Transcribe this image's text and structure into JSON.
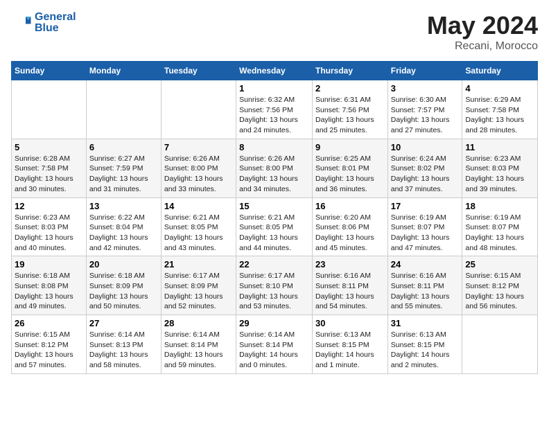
{
  "header": {
    "logo_line1": "General",
    "logo_line2": "Blue",
    "month": "May 2024",
    "location": "Recani, Morocco"
  },
  "weekdays": [
    "Sunday",
    "Monday",
    "Tuesday",
    "Wednesday",
    "Thursday",
    "Friday",
    "Saturday"
  ],
  "weeks": [
    [
      {
        "day": "",
        "info": ""
      },
      {
        "day": "",
        "info": ""
      },
      {
        "day": "",
        "info": ""
      },
      {
        "day": "1",
        "info": "Sunrise: 6:32 AM\nSunset: 7:56 PM\nDaylight: 13 hours\nand 24 minutes."
      },
      {
        "day": "2",
        "info": "Sunrise: 6:31 AM\nSunset: 7:56 PM\nDaylight: 13 hours\nand 25 minutes."
      },
      {
        "day": "3",
        "info": "Sunrise: 6:30 AM\nSunset: 7:57 PM\nDaylight: 13 hours\nand 27 minutes."
      },
      {
        "day": "4",
        "info": "Sunrise: 6:29 AM\nSunset: 7:58 PM\nDaylight: 13 hours\nand 28 minutes."
      }
    ],
    [
      {
        "day": "5",
        "info": "Sunrise: 6:28 AM\nSunset: 7:58 PM\nDaylight: 13 hours\nand 30 minutes."
      },
      {
        "day": "6",
        "info": "Sunrise: 6:27 AM\nSunset: 7:59 PM\nDaylight: 13 hours\nand 31 minutes."
      },
      {
        "day": "7",
        "info": "Sunrise: 6:26 AM\nSunset: 8:00 PM\nDaylight: 13 hours\nand 33 minutes."
      },
      {
        "day": "8",
        "info": "Sunrise: 6:26 AM\nSunset: 8:00 PM\nDaylight: 13 hours\nand 34 minutes."
      },
      {
        "day": "9",
        "info": "Sunrise: 6:25 AM\nSunset: 8:01 PM\nDaylight: 13 hours\nand 36 minutes."
      },
      {
        "day": "10",
        "info": "Sunrise: 6:24 AM\nSunset: 8:02 PM\nDaylight: 13 hours\nand 37 minutes."
      },
      {
        "day": "11",
        "info": "Sunrise: 6:23 AM\nSunset: 8:03 PM\nDaylight: 13 hours\nand 39 minutes."
      }
    ],
    [
      {
        "day": "12",
        "info": "Sunrise: 6:23 AM\nSunset: 8:03 PM\nDaylight: 13 hours\nand 40 minutes."
      },
      {
        "day": "13",
        "info": "Sunrise: 6:22 AM\nSunset: 8:04 PM\nDaylight: 13 hours\nand 42 minutes."
      },
      {
        "day": "14",
        "info": "Sunrise: 6:21 AM\nSunset: 8:05 PM\nDaylight: 13 hours\nand 43 minutes."
      },
      {
        "day": "15",
        "info": "Sunrise: 6:21 AM\nSunset: 8:05 PM\nDaylight: 13 hours\nand 44 minutes."
      },
      {
        "day": "16",
        "info": "Sunrise: 6:20 AM\nSunset: 8:06 PM\nDaylight: 13 hours\nand 45 minutes."
      },
      {
        "day": "17",
        "info": "Sunrise: 6:19 AM\nSunset: 8:07 PM\nDaylight: 13 hours\nand 47 minutes."
      },
      {
        "day": "18",
        "info": "Sunrise: 6:19 AM\nSunset: 8:07 PM\nDaylight: 13 hours\nand 48 minutes."
      }
    ],
    [
      {
        "day": "19",
        "info": "Sunrise: 6:18 AM\nSunset: 8:08 PM\nDaylight: 13 hours\nand 49 minutes."
      },
      {
        "day": "20",
        "info": "Sunrise: 6:18 AM\nSunset: 8:09 PM\nDaylight: 13 hours\nand 50 minutes."
      },
      {
        "day": "21",
        "info": "Sunrise: 6:17 AM\nSunset: 8:09 PM\nDaylight: 13 hours\nand 52 minutes."
      },
      {
        "day": "22",
        "info": "Sunrise: 6:17 AM\nSunset: 8:10 PM\nDaylight: 13 hours\nand 53 minutes."
      },
      {
        "day": "23",
        "info": "Sunrise: 6:16 AM\nSunset: 8:11 PM\nDaylight: 13 hours\nand 54 minutes."
      },
      {
        "day": "24",
        "info": "Sunrise: 6:16 AM\nSunset: 8:11 PM\nDaylight: 13 hours\nand 55 minutes."
      },
      {
        "day": "25",
        "info": "Sunrise: 6:15 AM\nSunset: 8:12 PM\nDaylight: 13 hours\nand 56 minutes."
      }
    ],
    [
      {
        "day": "26",
        "info": "Sunrise: 6:15 AM\nSunset: 8:12 PM\nDaylight: 13 hours\nand 57 minutes."
      },
      {
        "day": "27",
        "info": "Sunrise: 6:14 AM\nSunset: 8:13 PM\nDaylight: 13 hours\nand 58 minutes."
      },
      {
        "day": "28",
        "info": "Sunrise: 6:14 AM\nSunset: 8:14 PM\nDaylight: 13 hours\nand 59 minutes."
      },
      {
        "day": "29",
        "info": "Sunrise: 6:14 AM\nSunset: 8:14 PM\nDaylight: 14 hours\nand 0 minutes."
      },
      {
        "day": "30",
        "info": "Sunrise: 6:13 AM\nSunset: 8:15 PM\nDaylight: 14 hours\nand 1 minute."
      },
      {
        "day": "31",
        "info": "Sunrise: 6:13 AM\nSunset: 8:15 PM\nDaylight: 14 hours\nand 2 minutes."
      },
      {
        "day": "",
        "info": ""
      }
    ]
  ]
}
